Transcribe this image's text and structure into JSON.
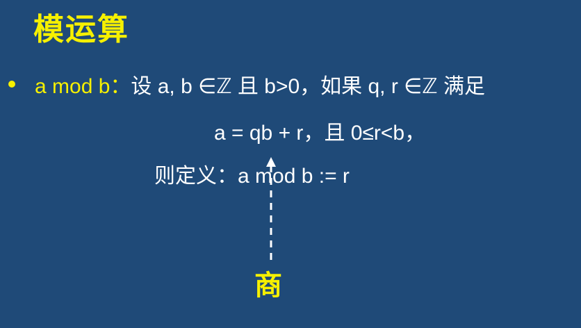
{
  "slide": {
    "title": "模运算",
    "bullet": {
      "term": "a mod b：",
      "definition": "设 a, b ∈ℤ 且 b>0，如果 q, r ∈ℤ 满足"
    },
    "equation": "a = qb + r，且 0≤r<b，",
    "conclusion": "则定义：a mod b := r",
    "annotation_label": "商"
  },
  "colors": {
    "background": "#1f4a78",
    "accent": "#f6f000",
    "text": "#ffffff"
  },
  "icons": {
    "bullet": "bullet-dot",
    "arrow": "dashed-up-arrow"
  }
}
